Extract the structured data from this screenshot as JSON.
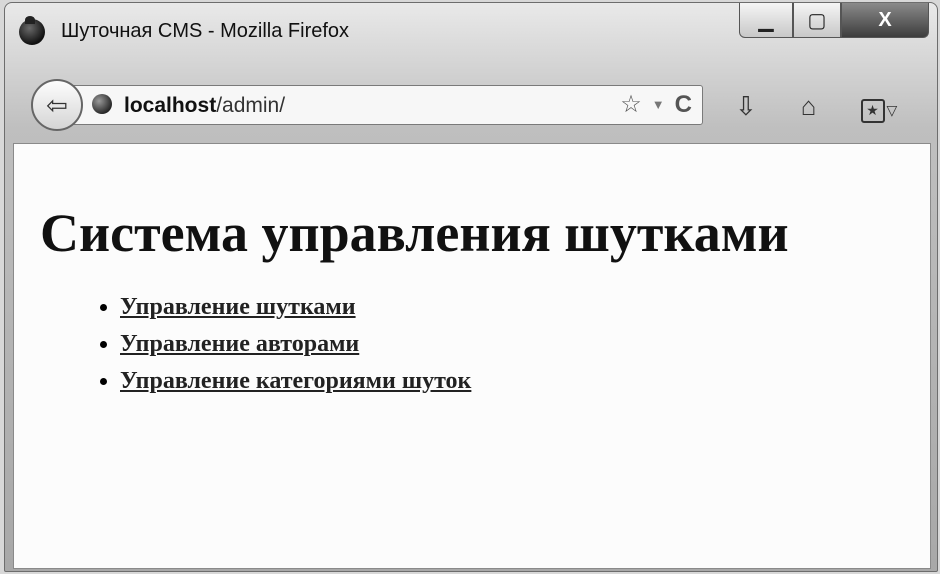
{
  "window": {
    "title": "Шуточная CMS - Mozilla Firefox",
    "controls": {
      "minimize": "▁",
      "maximize": "▢",
      "close": "X"
    }
  },
  "navbar": {
    "back_glyph": "⇦",
    "url_host": "localhost",
    "url_path": "/admin/",
    "star_glyph": "☆",
    "dropdown_glyph": "▼",
    "reload_glyph": "C",
    "download_glyph": "⇩",
    "home_glyph": "⌂",
    "bookmarks_glyph": "★",
    "menu_dropdown_glyph": "▽"
  },
  "page": {
    "heading": "Система управления шутками",
    "links": [
      {
        "label": "Управление шутками"
      },
      {
        "label": "Управление авторами"
      },
      {
        "label": "Управление категориями шуток"
      }
    ]
  }
}
